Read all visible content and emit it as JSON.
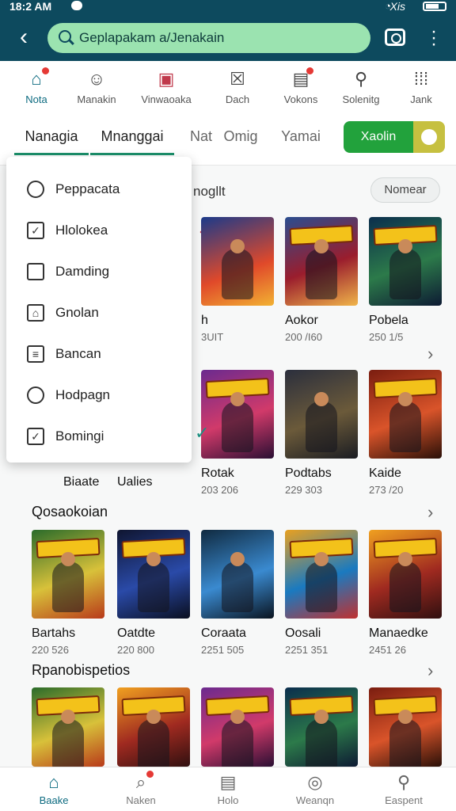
{
  "status_bar": {
    "time": "18:2 AM",
    "carrier": "Xis"
  },
  "search": {
    "value": "Geplapakam a/Jenakain"
  },
  "categories": [
    {
      "label": "Nota",
      "icon": "home-icon",
      "badge": true,
      "active": true
    },
    {
      "label": "Manakin",
      "icon": "robot-icon",
      "badge": false,
      "active": false
    },
    {
      "label": "Vinwaoaka",
      "icon": "calendar-icon",
      "badge": false,
      "active": false
    },
    {
      "label": "Dach",
      "icon": "close-box-icon",
      "badge": false,
      "active": false
    },
    {
      "label": "Vokons",
      "icon": "news-icon",
      "badge": true,
      "active": false
    },
    {
      "label": "Solenitg",
      "icon": "tag-icon",
      "badge": false,
      "active": false
    },
    {
      "label": "Jank",
      "icon": "grid-icon",
      "badge": false,
      "active": false
    }
  ],
  "tabs": [
    {
      "label": "Nanagia"
    },
    {
      "label": "Mnanggai"
    },
    {
      "label": "Nat"
    },
    {
      "label": "Omig"
    },
    {
      "label": "Yamai"
    }
  ],
  "toggle": {
    "label": "Xaolin"
  },
  "peek": {
    "text": "nogllt"
  },
  "name_button": {
    "label": "Nomear"
  },
  "menu": {
    "items": [
      {
        "label": "Peppacata",
        "icon": "search-icon"
      },
      {
        "label": "Hlolokea",
        "icon": "checkbox-icon"
      },
      {
        "label": "Damding",
        "icon": "bag-icon"
      },
      {
        "label": "Gnolan",
        "icon": "house-icon"
      },
      {
        "label": "Bancan",
        "icon": "list-icon"
      },
      {
        "label": "Hodpagn",
        "icon": "search-icon"
      },
      {
        "label": "Bomingi",
        "icon": "checkbox-icon"
      }
    ],
    "checked_index": 6
  },
  "row1": [
    {
      "title": "h",
      "meta": "3UIT"
    },
    {
      "title": "Aokor",
      "meta": "200 /I60"
    },
    {
      "title": "Pobela",
      "meta": "250 1/5"
    }
  ],
  "row2": [
    {
      "title": "Biaate",
      "meta": ""
    },
    {
      "title": "Ualies",
      "meta": ""
    },
    {
      "title": "Rotak",
      "meta": "203 206"
    },
    {
      "title": "Podtabs",
      "meta": "229 303"
    },
    {
      "title": "Kaide",
      "meta": "273 /20"
    }
  ],
  "section2": {
    "title": "Qosaokoian",
    "games": [
      {
        "title": "Bartahs",
        "meta": "220 526"
      },
      {
        "title": "Oatdte",
        "meta": "220 800"
      },
      {
        "title": "Coraata",
        "meta": "2251 505"
      },
      {
        "title": "Oosali",
        "meta": "2251 351"
      },
      {
        "title": "Manaedke",
        "meta": "2451 26"
      }
    ]
  },
  "section3": {
    "title": "Rpanobispetios"
  },
  "bottom_nav": [
    {
      "label": "Baake",
      "icon": "home-icon",
      "badge": false,
      "active": true
    },
    {
      "label": "Naken",
      "icon": "bell-icon",
      "badge": true,
      "active": false
    },
    {
      "label": "Holo",
      "icon": "doc-icon",
      "badge": false,
      "active": false
    },
    {
      "label": "Weanqn",
      "icon": "chat-icon",
      "badge": false,
      "active": false
    },
    {
      "label": "Easpent",
      "icon": "search-icon",
      "badge": false,
      "active": false
    }
  ]
}
